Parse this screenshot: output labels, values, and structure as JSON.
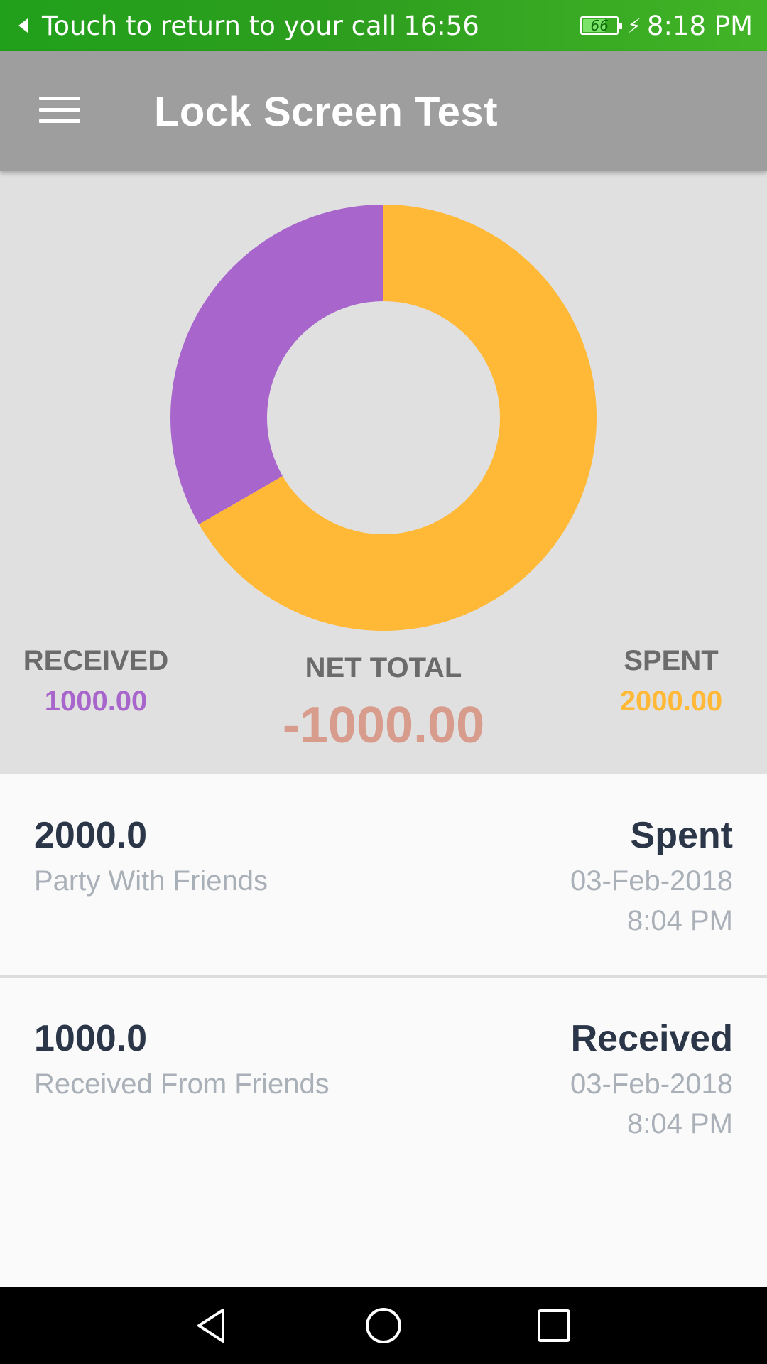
{
  "status_bar": {
    "call_text": "Touch to return to your call",
    "call_timer": "16:56",
    "battery_level": "66",
    "time": "8:18 PM"
  },
  "app_bar": {
    "title": "Lock Screen Test",
    "menu_icon": "hamburger-menu-icon"
  },
  "summary": {
    "received_label": "RECEIVED",
    "received_value": "1000.00",
    "net_total_label": "NET TOTAL",
    "net_total_value": "-1000.00",
    "spent_label": "SPENT",
    "spent_value": "2000.00",
    "colors": {
      "received": "#a866cc",
      "spent": "#ffb936",
      "net_total": "#d89c8d",
      "panel_background": "#e0e0e0"
    }
  },
  "chart_data": {
    "type": "pie",
    "title": "",
    "style": "donut",
    "slices": [
      {
        "label": "Spent",
        "value": 2000,
        "color": "#ffb936"
      },
      {
        "label": "Received",
        "value": 1000,
        "color": "#a866cc"
      }
    ]
  },
  "transactions": [
    {
      "amount": "2000.0",
      "description": "Party With Friends",
      "type": "Spent",
      "date": "03-Feb-2018",
      "time": "8:04 PM"
    },
    {
      "amount": "1000.0",
      "description": "Received From Friends",
      "type": "Received",
      "date": "03-Feb-2018",
      "time": "8:04 PM"
    }
  ],
  "nav_bar": {
    "back_icon": "back-triangle-icon",
    "home_icon": "home-circle-icon",
    "recent_icon": "recent-apps-square-icon"
  }
}
